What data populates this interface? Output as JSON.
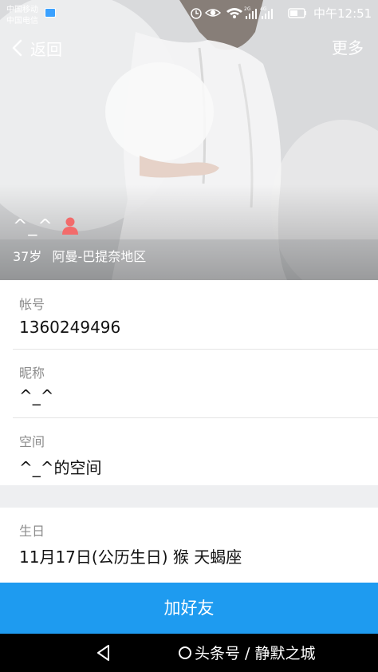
{
  "status_bar": {
    "carrier1": "中国移动",
    "carrier2": "中国电信",
    "network_1": "2G",
    "network_2": "4G",
    "time": "中午12:51"
  },
  "nav": {
    "back_label": "返回",
    "more_label": "更多"
  },
  "profile": {
    "name": "^_^",
    "age": "37岁",
    "region": "阿曼-巴提奈地区",
    "gender_icon_color": "#f26b6b"
  },
  "fields": [
    {
      "label": "帐号",
      "value": "1360249496"
    },
    {
      "label": "昵称",
      "value": "^_^"
    },
    {
      "label": "空间",
      "value": "^_^的空间"
    },
    {
      "label": "生日",
      "value": "11月17日(公历生日) 猴 天蝎座"
    }
  ],
  "add_friend_label": "加好友",
  "accent_color": "#1e9bf0",
  "watermark": {
    "text": "头条号 ∕ 静默之城"
  }
}
